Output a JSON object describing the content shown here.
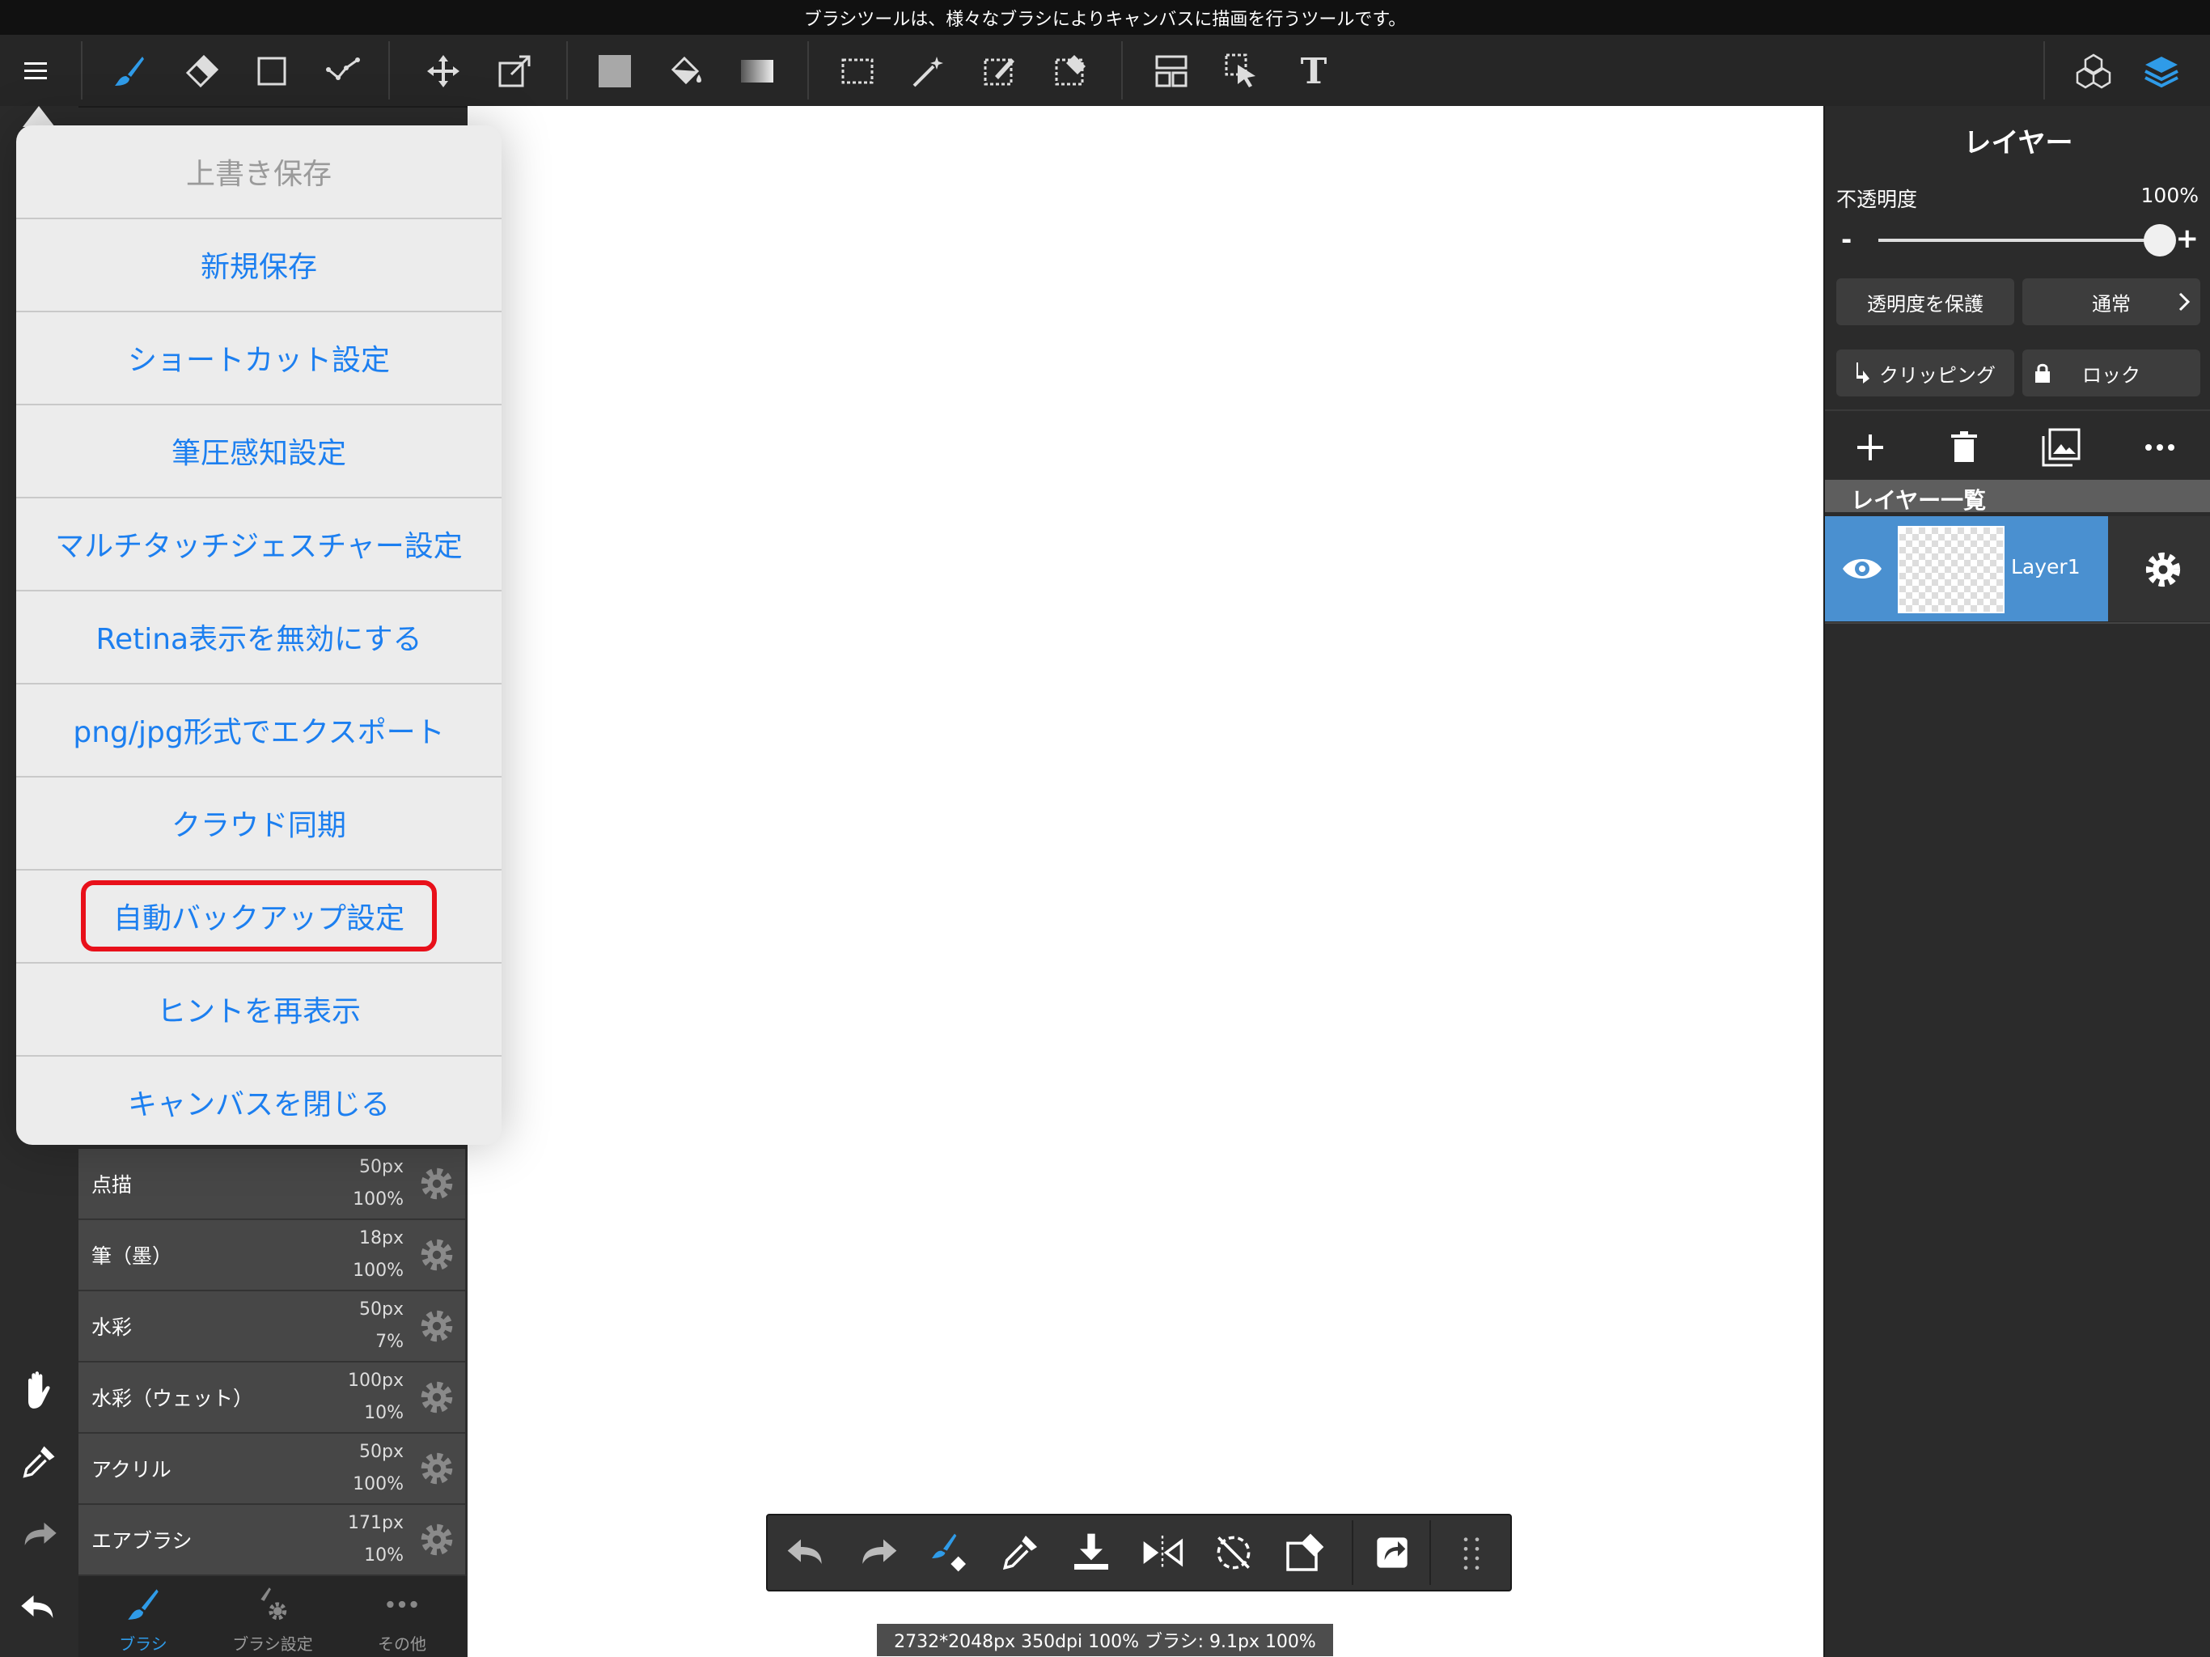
{
  "hint_bar": {
    "text": "ブラシツールは、様々なブラシによりキャンバスに描画を行うツールです。"
  },
  "toolbar": {
    "icons": [
      "menu-icon",
      "brush-icon",
      "eraser-icon",
      "rectangle-icon",
      "polyline-icon",
      "move-icon",
      "transform-icon",
      "fill-color-icon",
      "bucket-icon",
      "gradient-icon",
      "select-rect-icon",
      "magic-wand-icon",
      "select-pen-icon",
      "select-eraser-icon",
      "layout-icon",
      "select-cursor-icon",
      "text-icon",
      "3d-model-icon",
      "layers-icon"
    ],
    "text_tool_label": "T",
    "accent_color": "#2f9be8"
  },
  "menu": {
    "items": [
      {
        "label": "上書き保存",
        "enabled": false
      },
      {
        "label": "新規保存",
        "enabled": true
      },
      {
        "label": "ショートカット設定",
        "enabled": true
      },
      {
        "label": "筆圧感知設定",
        "enabled": true
      },
      {
        "label": "マルチタッチジェスチャー設定",
        "enabled": true
      },
      {
        "label": "Retina表示を無効にする",
        "enabled": true
      },
      {
        "label": "png/jpg形式でエクスポート",
        "enabled": true
      },
      {
        "label": "クラウド同期",
        "enabled": true
      },
      {
        "label": "自動バックアップ設定",
        "enabled": true,
        "highlighted": true
      },
      {
        "label": "ヒントを再表示",
        "enabled": true
      },
      {
        "label": "キャンバスを閉じる",
        "enabled": true
      }
    ],
    "link_color": "#1c7ff0",
    "disabled_color": "#9a9a9a",
    "highlight_color": "#e8101a"
  },
  "brushes": [
    {
      "name": "点描",
      "size": "50px",
      "opacity": "100%"
    },
    {
      "name": "筆（墨）",
      "size": "18px",
      "opacity": "100%"
    },
    {
      "name": "水彩",
      "size": "50px",
      "opacity": "7%"
    },
    {
      "name": "水彩（ウェット）",
      "size": "100px",
      "opacity": "10%"
    },
    {
      "name": "アクリル",
      "size": "50px",
      "opacity": "100%"
    },
    {
      "name": "エアブラシ",
      "size": "171px",
      "opacity": "10%"
    }
  ],
  "brush_tabs": [
    {
      "label": "ブラシ",
      "active": true
    },
    {
      "label": "ブラシ設定",
      "active": false
    },
    {
      "label": "その他",
      "active": false
    }
  ],
  "layer_panel": {
    "title": "レイヤー",
    "opacity_label": "不透明度",
    "opacity_value": "100%",
    "opacity_fraction": 1.0,
    "minus": "-",
    "plus": "+",
    "protect_alpha": "透明度を保護",
    "blend_mode": "通常",
    "clipping": "クリッピング",
    "lock": "ロック",
    "list_header": "レイヤー一覧",
    "layers": [
      {
        "name": "Layer1",
        "visible": true,
        "selected": true
      }
    ],
    "selected_color": "#4a90d0"
  },
  "bottom_toolbar": {
    "icons": [
      "undo-icon",
      "redo-icon",
      "brush-swap-icon",
      "eyedropper-icon",
      "import-icon",
      "flip-icon",
      "rotate-reset-icon",
      "clear-icon",
      "share-icon",
      "grid-icon"
    ]
  },
  "status_bar": {
    "text": "2732*2048px 350dpi 100% ブラシ: 9.1px 100%"
  },
  "left_tools": [
    "hand-icon",
    "eyedropper-icon",
    "redo-icon",
    "undo-icon"
  ]
}
